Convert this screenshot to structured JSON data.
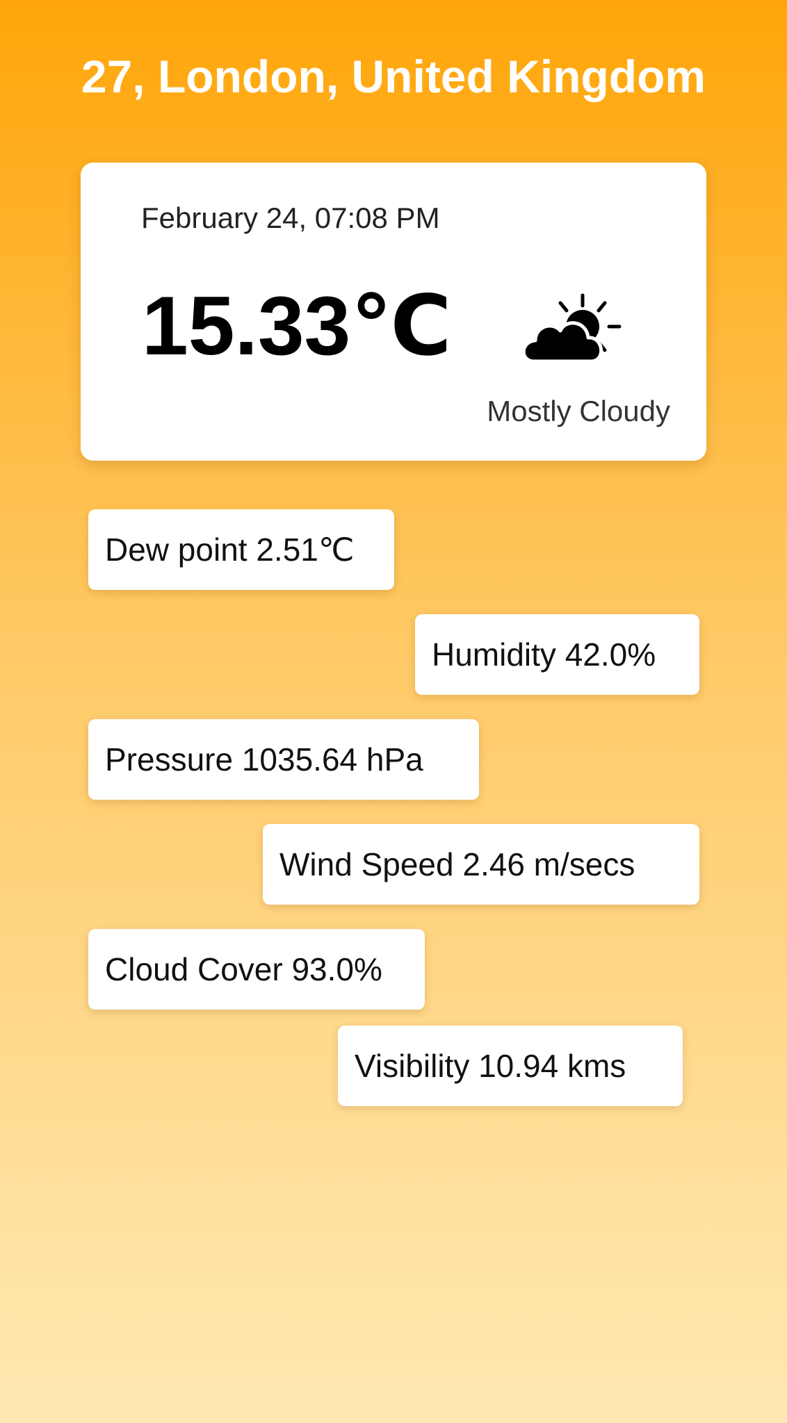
{
  "header": {
    "location": "27, London, United Kingdom"
  },
  "current": {
    "date_time": "February 24, 07:08 PM",
    "temperature": "15.33℃",
    "condition": "Mostly Cloudy",
    "icon": "partly-cloudy-icon"
  },
  "stats": {
    "dew_point": "Dew point 2.51℃",
    "humidity": "Humidity 42.0%",
    "pressure": "Pressure 1035.64 hPa",
    "wind_speed": "Wind Speed 2.46 m/secs",
    "cloud_cover": "Cloud Cover 93.0%",
    "visibility": "Visibility 10.94 kms"
  },
  "colors": {
    "gradient_top": "#ffa509",
    "gradient_bottom": "#ffe9b3",
    "card": "#ffffff"
  }
}
